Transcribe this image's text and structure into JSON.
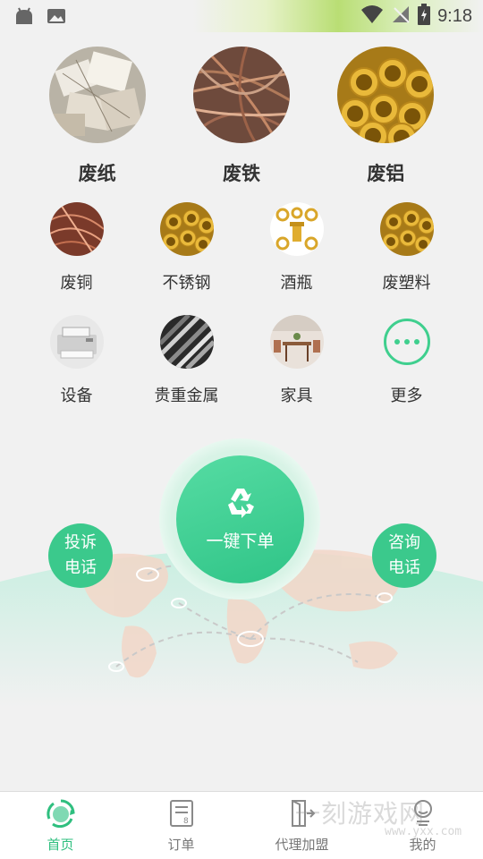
{
  "status_bar": {
    "time": "9:18",
    "icons": [
      "android-icon",
      "image-icon",
      "wifi-icon",
      "signal-icon",
      "battery-icon"
    ]
  },
  "big_categories": [
    {
      "label": "废纸",
      "icon": "waste-paper-photo"
    },
    {
      "label": "废铁",
      "icon": "scrap-iron-photo"
    },
    {
      "label": "废铝",
      "icon": "scrap-aluminum-photo"
    }
  ],
  "small_categories": [
    {
      "label": "废铜",
      "icon": "copper-wire-photo"
    },
    {
      "label": "不锈钢",
      "icon": "brass-pipe-photo"
    },
    {
      "label": "酒瓶",
      "icon": "brass-fittings-photo"
    },
    {
      "label": "废塑料",
      "icon": "brass-pipe-photo"
    },
    {
      "label": "设备",
      "icon": "printer-photo"
    },
    {
      "label": "贵重金属",
      "icon": "metal-bars-photo"
    },
    {
      "label": "家具",
      "icon": "furniture-photo"
    },
    {
      "label": "更多",
      "icon": "more-icon"
    }
  ],
  "center_action": {
    "label": "一键下单",
    "icon": "recycle-icon"
  },
  "side_actions": {
    "left": {
      "line1": "投诉",
      "line2": "电话"
    },
    "right": {
      "line1": "咨询",
      "line2": "电话"
    }
  },
  "bottom_nav": [
    {
      "label": "首页",
      "icon": "home-recycle-icon",
      "active": true
    },
    {
      "label": "订单",
      "icon": "order-icon",
      "active": false
    },
    {
      "label": "代理加盟",
      "icon": "agent-icon",
      "active": false
    },
    {
      "label": "我的",
      "icon": "profile-icon",
      "active": false
    }
  ],
  "watermark": {
    "text": "一刻游戏网",
    "sub": "www.yxx.com"
  },
  "colors": {
    "accent": "#3bc98c",
    "accent_light": "#56dca3",
    "active_nav": "#2fbf7f"
  }
}
